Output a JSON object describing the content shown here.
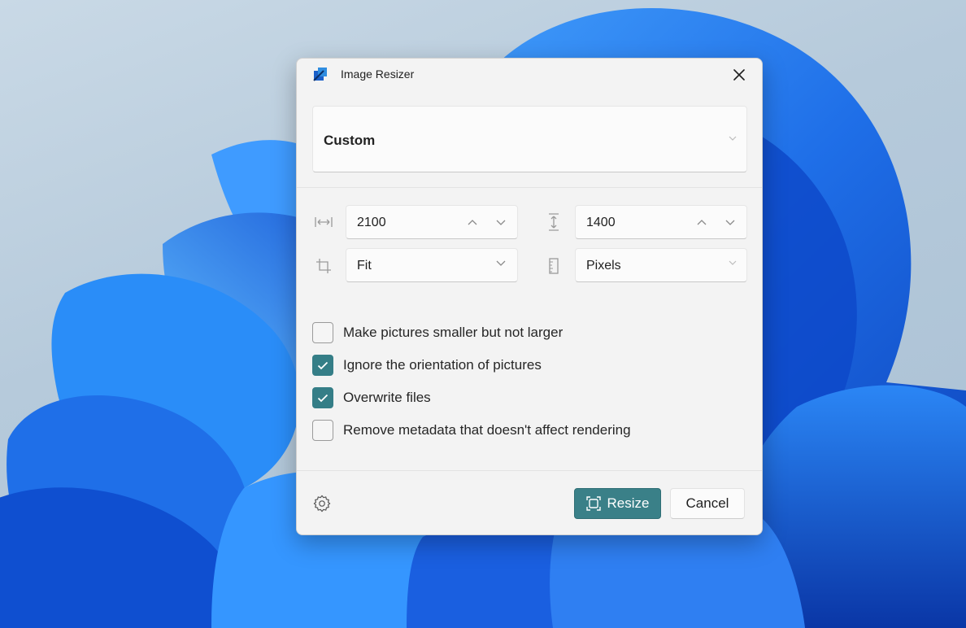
{
  "window": {
    "title": "Image Resizer",
    "app_icon": "image-resizer-icon",
    "close_icon": "close-icon"
  },
  "preset": {
    "selected": "Custom"
  },
  "dimensions": {
    "width_value": "2100",
    "height_value": "1400",
    "fit_selected": "Fit",
    "unit_selected": "Pixels",
    "icons": [
      "width-icon",
      "height-icon",
      "crop-icon",
      "ruler-icon",
      "chevron-up-icon",
      "chevron-down-icon"
    ]
  },
  "options": [
    {
      "label": "Make pictures smaller but not larger",
      "checked": false
    },
    {
      "label": "Ignore the orientation of pictures",
      "checked": true
    },
    {
      "label": "Overwrite files",
      "checked": true
    },
    {
      "label": "Remove metadata that doesn't affect rendering",
      "checked": false
    }
  ],
  "footer": {
    "resize_label": "Resize",
    "cancel_label": "Cancel",
    "settings_icon": "gear-icon",
    "resize_icon": "resize-icon"
  },
  "colors": {
    "accent": "#3a8088",
    "wallpaper_blue": "#1f6fe8",
    "dialog_bg": "#f3f3f3"
  }
}
